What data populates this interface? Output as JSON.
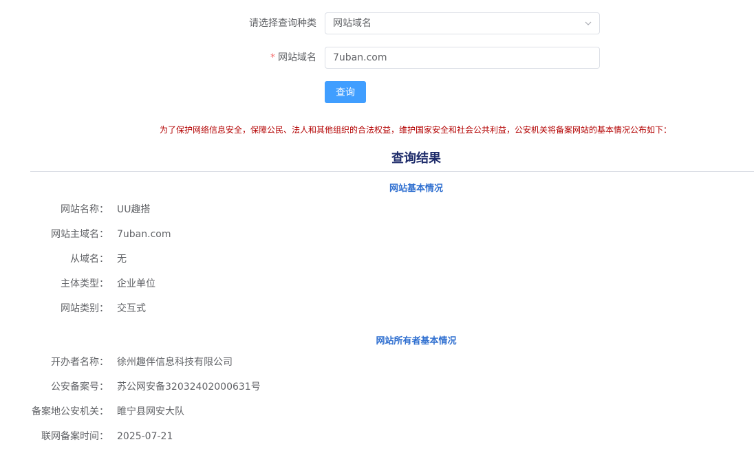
{
  "form": {
    "type_label": "请选择查询种类",
    "type_value": "网站域名",
    "domain_required_mark": "*",
    "domain_label": "网站域名",
    "domain_value": "7uban.com",
    "query_button": "查询"
  },
  "notice": "为了保护网络信息安全，保障公民、法人和其他组织的合法权益，维护国家安全和社会公共利益，公安机关将备案网站的基本情况公布如下：",
  "result_title": "查询结果",
  "site_section": {
    "title": "网站基本情况",
    "rows": [
      {
        "label": "网站名称：",
        "value": "UU趣搭"
      },
      {
        "label": "网站主域名：",
        "value": "7uban.com"
      },
      {
        "label": "从域名：",
        "value": "无"
      },
      {
        "label": "主体类型：",
        "value": "企业单位"
      },
      {
        "label": "网站类别：",
        "value": "交互式"
      }
    ]
  },
  "owner_section": {
    "title": "网站所有者基本情况",
    "rows": [
      {
        "label": "开办者名称：",
        "value": "徐州趣伴信息科技有限公司"
      },
      {
        "label": "公安备案号：",
        "value": "苏公网安备32032402000631号"
      },
      {
        "label": "备案地公安机关：",
        "value": "睢宁县网安大队"
      },
      {
        "label": "联网备案时间：",
        "value": "2025-07-21"
      }
    ]
  }
}
